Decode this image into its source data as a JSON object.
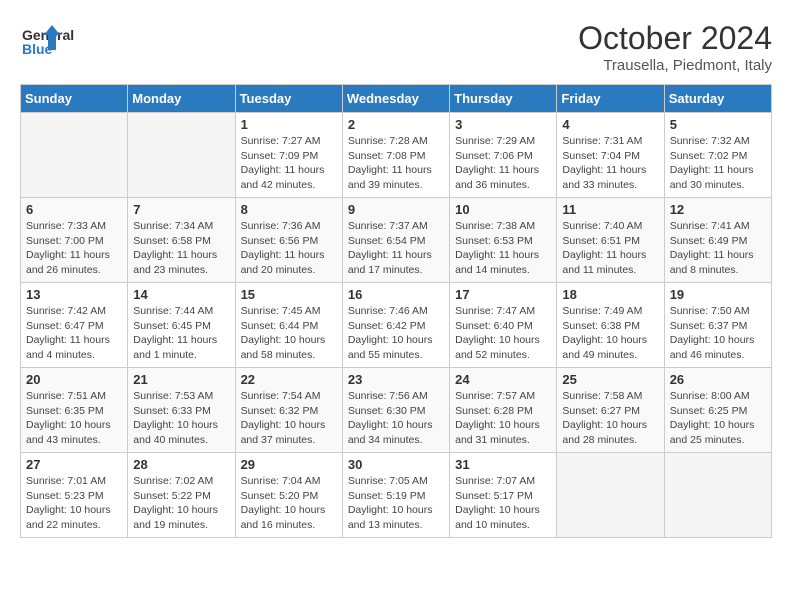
{
  "header": {
    "logo_line1": "General",
    "logo_line2": "Blue",
    "month_title": "October 2024",
    "location": "Trausella, Piedmont, Italy"
  },
  "days_of_week": [
    "Sunday",
    "Monday",
    "Tuesday",
    "Wednesday",
    "Thursday",
    "Friday",
    "Saturday"
  ],
  "weeks": [
    [
      {
        "day": "",
        "empty": true
      },
      {
        "day": "",
        "empty": true
      },
      {
        "day": "1",
        "sunrise": "7:27 AM",
        "sunset": "7:09 PM",
        "daylight": "11 hours and 42 minutes."
      },
      {
        "day": "2",
        "sunrise": "7:28 AM",
        "sunset": "7:08 PM",
        "daylight": "11 hours and 39 minutes."
      },
      {
        "day": "3",
        "sunrise": "7:29 AM",
        "sunset": "7:06 PM",
        "daylight": "11 hours and 36 minutes."
      },
      {
        "day": "4",
        "sunrise": "7:31 AM",
        "sunset": "7:04 PM",
        "daylight": "11 hours and 33 minutes."
      },
      {
        "day": "5",
        "sunrise": "7:32 AM",
        "sunset": "7:02 PM",
        "daylight": "11 hours and 30 minutes."
      }
    ],
    [
      {
        "day": "6",
        "sunrise": "7:33 AM",
        "sunset": "7:00 PM",
        "daylight": "11 hours and 26 minutes."
      },
      {
        "day": "7",
        "sunrise": "7:34 AM",
        "sunset": "6:58 PM",
        "daylight": "11 hours and 23 minutes."
      },
      {
        "day": "8",
        "sunrise": "7:36 AM",
        "sunset": "6:56 PM",
        "daylight": "11 hours and 20 minutes."
      },
      {
        "day": "9",
        "sunrise": "7:37 AM",
        "sunset": "6:54 PM",
        "daylight": "11 hours and 17 minutes."
      },
      {
        "day": "10",
        "sunrise": "7:38 AM",
        "sunset": "6:53 PM",
        "daylight": "11 hours and 14 minutes."
      },
      {
        "day": "11",
        "sunrise": "7:40 AM",
        "sunset": "6:51 PM",
        "daylight": "11 hours and 11 minutes."
      },
      {
        "day": "12",
        "sunrise": "7:41 AM",
        "sunset": "6:49 PM",
        "daylight": "11 hours and 8 minutes."
      }
    ],
    [
      {
        "day": "13",
        "sunrise": "7:42 AM",
        "sunset": "6:47 PM",
        "daylight": "11 hours and 4 minutes."
      },
      {
        "day": "14",
        "sunrise": "7:44 AM",
        "sunset": "6:45 PM",
        "daylight": "11 hours and 1 minute."
      },
      {
        "day": "15",
        "sunrise": "7:45 AM",
        "sunset": "6:44 PM",
        "daylight": "10 hours and 58 minutes."
      },
      {
        "day": "16",
        "sunrise": "7:46 AM",
        "sunset": "6:42 PM",
        "daylight": "10 hours and 55 minutes."
      },
      {
        "day": "17",
        "sunrise": "7:47 AM",
        "sunset": "6:40 PM",
        "daylight": "10 hours and 52 minutes."
      },
      {
        "day": "18",
        "sunrise": "7:49 AM",
        "sunset": "6:38 PM",
        "daylight": "10 hours and 49 minutes."
      },
      {
        "day": "19",
        "sunrise": "7:50 AM",
        "sunset": "6:37 PM",
        "daylight": "10 hours and 46 minutes."
      }
    ],
    [
      {
        "day": "20",
        "sunrise": "7:51 AM",
        "sunset": "6:35 PM",
        "daylight": "10 hours and 43 minutes."
      },
      {
        "day": "21",
        "sunrise": "7:53 AM",
        "sunset": "6:33 PM",
        "daylight": "10 hours and 40 minutes."
      },
      {
        "day": "22",
        "sunrise": "7:54 AM",
        "sunset": "6:32 PM",
        "daylight": "10 hours and 37 minutes."
      },
      {
        "day": "23",
        "sunrise": "7:56 AM",
        "sunset": "6:30 PM",
        "daylight": "10 hours and 34 minutes."
      },
      {
        "day": "24",
        "sunrise": "7:57 AM",
        "sunset": "6:28 PM",
        "daylight": "10 hours and 31 minutes."
      },
      {
        "day": "25",
        "sunrise": "7:58 AM",
        "sunset": "6:27 PM",
        "daylight": "10 hours and 28 minutes."
      },
      {
        "day": "26",
        "sunrise": "8:00 AM",
        "sunset": "6:25 PM",
        "daylight": "10 hours and 25 minutes."
      }
    ],
    [
      {
        "day": "27",
        "sunrise": "7:01 AM",
        "sunset": "5:23 PM",
        "daylight": "10 hours and 22 minutes."
      },
      {
        "day": "28",
        "sunrise": "7:02 AM",
        "sunset": "5:22 PM",
        "daylight": "10 hours and 19 minutes."
      },
      {
        "day": "29",
        "sunrise": "7:04 AM",
        "sunset": "5:20 PM",
        "daylight": "10 hours and 16 minutes."
      },
      {
        "day": "30",
        "sunrise": "7:05 AM",
        "sunset": "5:19 PM",
        "daylight": "10 hours and 13 minutes."
      },
      {
        "day": "31",
        "sunrise": "7:07 AM",
        "sunset": "5:17 PM",
        "daylight": "10 hours and 10 minutes."
      },
      {
        "day": "",
        "empty": true
      },
      {
        "day": "",
        "empty": true
      }
    ]
  ],
  "labels": {
    "sunrise": "Sunrise:",
    "sunset": "Sunset:",
    "daylight": "Daylight:"
  }
}
